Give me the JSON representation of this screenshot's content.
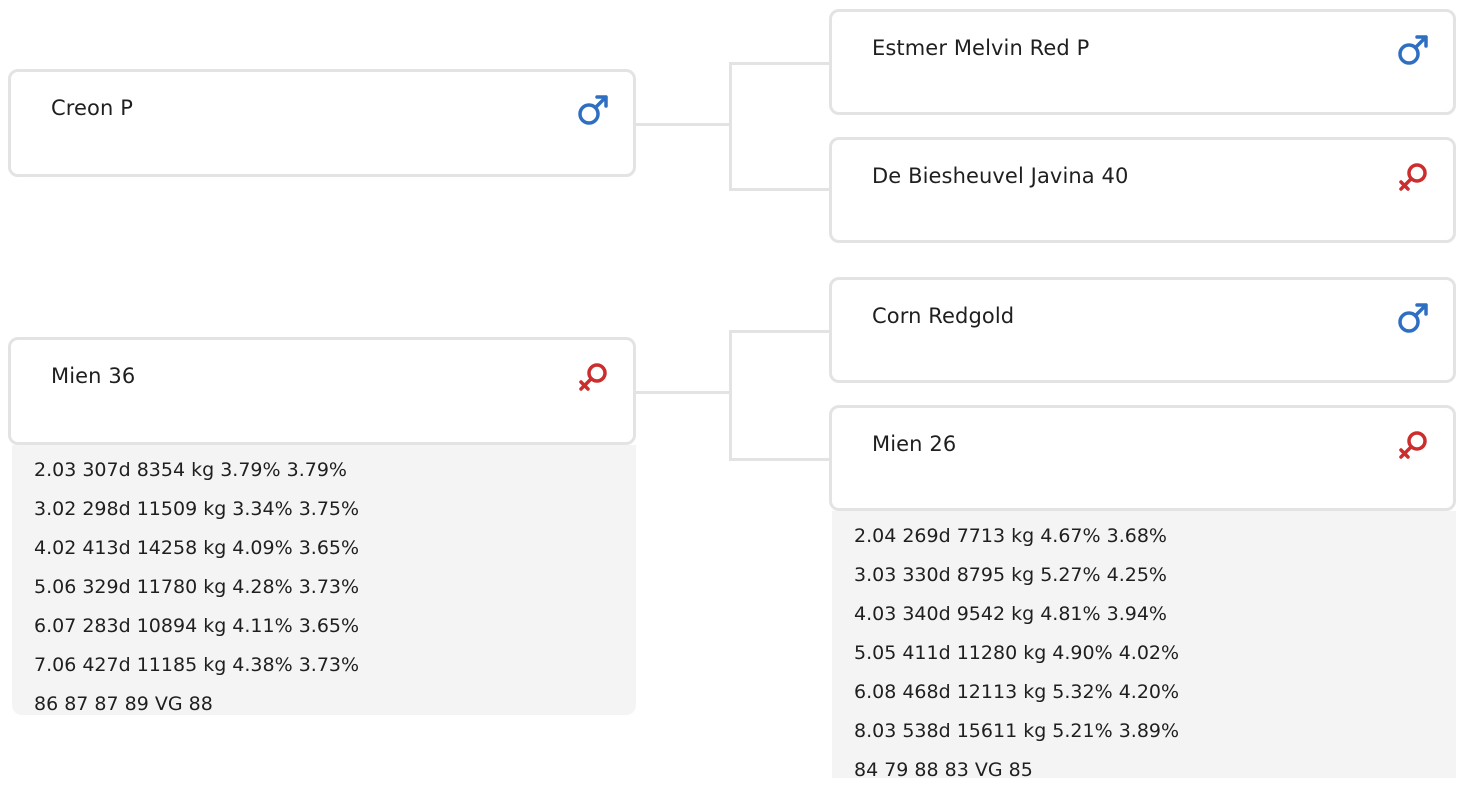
{
  "animals": {
    "sire": {
      "name": "Creon P",
      "sex": "male",
      "sex_icon": "male-icon",
      "color": "#2f6fc1"
    },
    "dam": {
      "name": "Mien 36",
      "sex": "female",
      "sex_icon": "female-icon",
      "color": "#cc2d2d",
      "stats": [
        "2.03 307d 8354 kg 3.79% 3.79%",
        "3.02 298d 11509 kg 3.34% 3.75%",
        "4.02 413d 14258 kg 4.09% 3.65%",
        "5.06 329d 11780 kg 4.28% 3.73%",
        "6.07 283d 10894 kg 4.11% 3.65%",
        "7.06 427d 11185 kg 4.38% 3.73%",
        "86 87 87 89 VG 88"
      ]
    },
    "sire_sire": {
      "name": "Estmer Melvin Red P",
      "sex": "male",
      "sex_icon": "male-icon",
      "color": "#2f6fc1"
    },
    "sire_dam": {
      "name": "De Biesheuvel Javina 40",
      "sex": "female",
      "sex_icon": "female-icon",
      "color": "#cc2d2d"
    },
    "dam_sire": {
      "name": "Corn Redgold",
      "sex": "male",
      "sex_icon": "male-icon",
      "color": "#2f6fc1"
    },
    "dam_dam": {
      "name": "Mien 26",
      "sex": "female",
      "sex_icon": "female-icon",
      "color": "#cc2d2d",
      "stats": [
        "2.04 269d 7713 kg 4.67% 3.68%",
        "3.03 330d 8795 kg 5.27% 4.25%",
        "4.03 340d 9542 kg 4.81% 3.94%",
        "5.05 411d 11280 kg 4.90% 4.02%",
        "6.08 468d 12113 kg 5.32% 4.20%",
        "8.03 538d 15611 kg 5.21% 3.89%",
        "84 79 88 83 VG 85"
      ]
    }
  }
}
